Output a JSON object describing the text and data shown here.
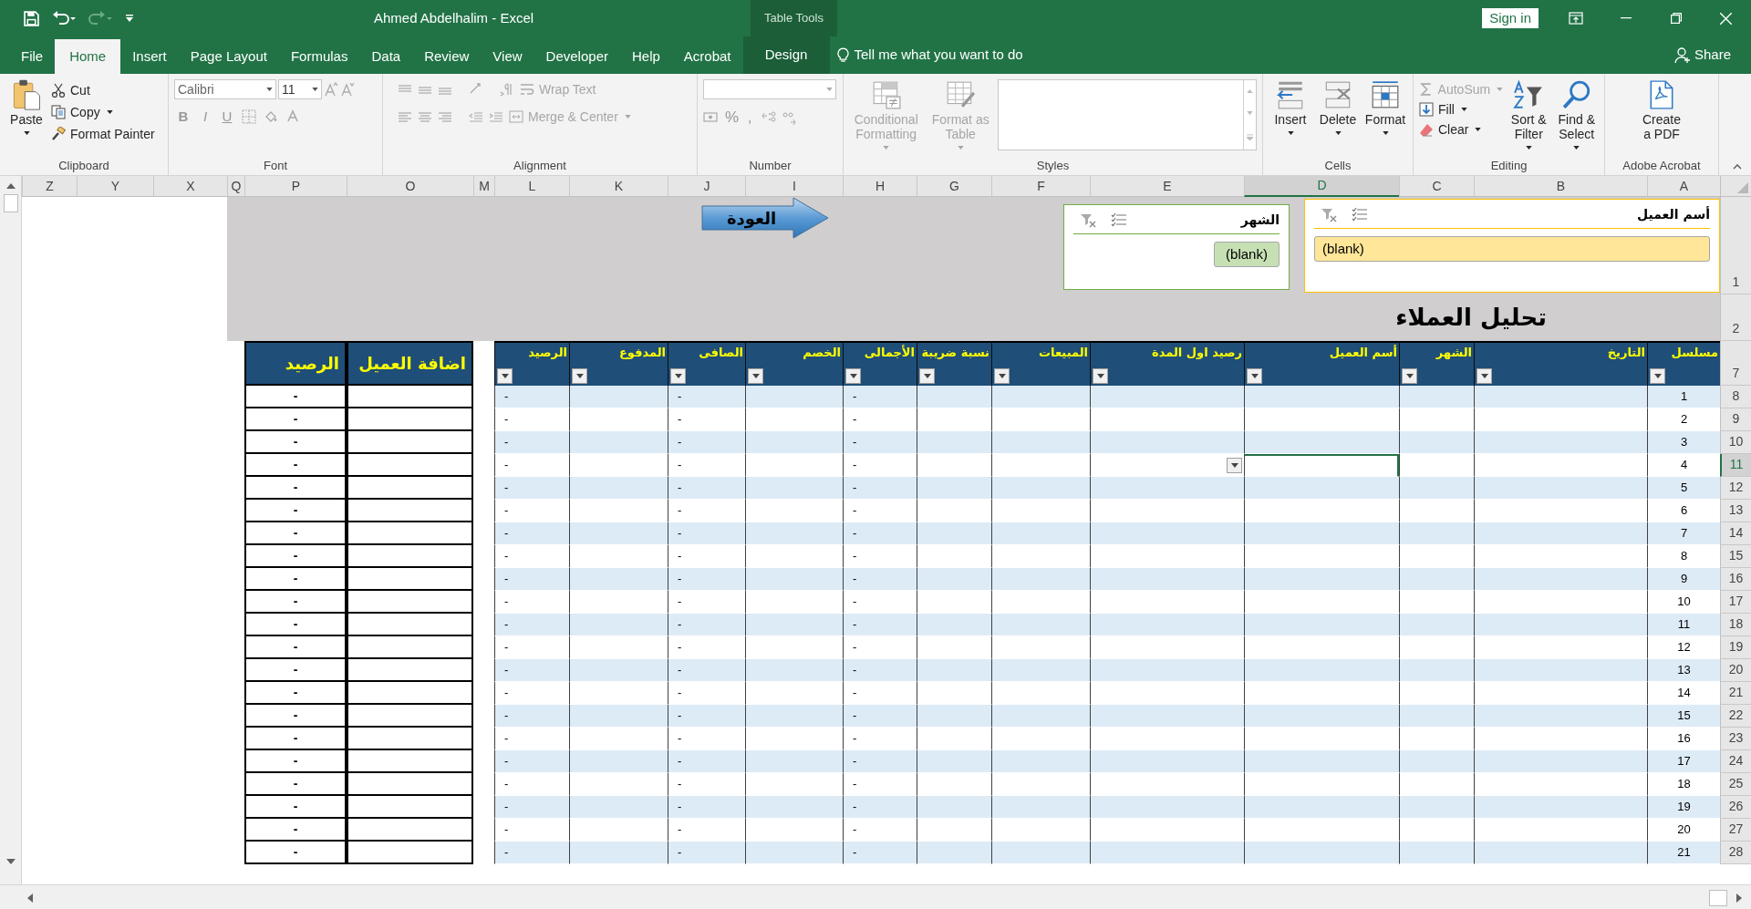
{
  "window": {
    "title": "Ahmed Abdelhalim  -  Excel",
    "context_label": "Table Tools",
    "sign_in": "Sign in"
  },
  "ribbon_tabs": [
    {
      "label": "File",
      "selected": false,
      "kind": "tab"
    },
    {
      "label": "Home",
      "selected": true,
      "kind": "tab"
    },
    {
      "label": "Insert",
      "selected": false,
      "kind": "tab"
    },
    {
      "label": "Page Layout",
      "selected": false,
      "kind": "tab"
    },
    {
      "label": "Formulas",
      "selected": false,
      "kind": "tab"
    },
    {
      "label": "Data",
      "selected": false,
      "kind": "tab"
    },
    {
      "label": "Review",
      "selected": false,
      "kind": "tab"
    },
    {
      "label": "View",
      "selected": false,
      "kind": "tab"
    },
    {
      "label": "Developer",
      "selected": false,
      "kind": "tab"
    },
    {
      "label": "Help",
      "selected": false,
      "kind": "tab"
    },
    {
      "label": "Acrobat",
      "selected": false,
      "kind": "tab"
    },
    {
      "label": "Design",
      "selected": false,
      "kind": "contextual"
    }
  ],
  "tell_me": "Tell me what you want to do",
  "share": "Share",
  "ribbon_groups": [
    {
      "kind": "clipboard",
      "name": "Clipboard",
      "commands": [
        {
          "label": "Paste",
          "disabled": false,
          "dropdown": true
        },
        {
          "label": "Cut",
          "disabled": false,
          "dropdown": false
        },
        {
          "label": "Copy",
          "disabled": false,
          "dropdown": true
        },
        {
          "label": "Format Painter",
          "disabled": false,
          "dropdown": false
        }
      ]
    },
    {
      "kind": "font",
      "name": "Font",
      "font_name": "Calibri",
      "font_size": "11",
      "format_buttons": [
        "B",
        "I",
        "U"
      ]
    },
    {
      "kind": "alignment",
      "name": "Alignment",
      "commands": [
        {
          "label": "Wrap Text",
          "disabled": true,
          "dropdown": false
        },
        {
          "label": "Merge & Center",
          "disabled": true,
          "dropdown": true
        }
      ]
    },
    {
      "kind": "number",
      "name": "Number",
      "symbols": [
        "%",
        ","
      ]
    },
    {
      "kind": "styles",
      "name": "Styles",
      "commands": [
        {
          "label": "Conditional\nFormatting",
          "disabled": true,
          "dropdown": true
        },
        {
          "label": "Format as\nTable",
          "disabled": true,
          "dropdown": true
        }
      ]
    },
    {
      "kind": "cells",
      "name": "Cells",
      "commands": [
        {
          "label": "Insert",
          "disabled": false,
          "dropdown": true
        },
        {
          "label": "Delete",
          "disabled": false,
          "dropdown": true
        },
        {
          "label": "Format",
          "disabled": false,
          "dropdown": true
        }
      ]
    },
    {
      "kind": "editing",
      "name": "Editing",
      "commands": [
        {
          "label": "AutoSum",
          "disabled": true,
          "dropdown": true
        },
        {
          "label": "Fill",
          "disabled": false,
          "dropdown": true
        },
        {
          "label": "Clear",
          "disabled": false,
          "dropdown": true
        },
        {
          "label": "Sort &\nFilter",
          "disabled": false,
          "dropdown": true
        },
        {
          "label": "Find &\nSelect",
          "disabled": false,
          "dropdown": true
        }
      ]
    },
    {
      "kind": "acrobat",
      "name": "Adobe Acrobat",
      "commands": [
        {
          "label": "Create\na PDF",
          "disabled": false,
          "dropdown": false
        }
      ]
    }
  ],
  "sheet": {
    "column_headers": [
      {
        "label": "Z",
        "selected": false
      },
      {
        "label": "Y",
        "selected": false
      },
      {
        "label": "X",
        "selected": false
      },
      {
        "label": "Q",
        "selected": false
      },
      {
        "label": "P",
        "selected": false
      },
      {
        "label": "O",
        "selected": false
      },
      {
        "label": "M",
        "selected": false
      },
      {
        "label": "L",
        "selected": false
      },
      {
        "label": "K",
        "selected": false
      },
      {
        "label": "J",
        "selected": false
      },
      {
        "label": "I",
        "selected": false
      },
      {
        "label": "H",
        "selected": false
      },
      {
        "label": "G",
        "selected": false
      },
      {
        "label": "F",
        "selected": false
      },
      {
        "label": "E",
        "selected": false
      },
      {
        "label": "D",
        "selected": true
      },
      {
        "label": "C",
        "selected": false
      },
      {
        "label": "B",
        "selected": false
      },
      {
        "label": "A",
        "selected": false
      }
    ],
    "top_rows": [
      "1",
      "2"
    ],
    "slicers": [
      {
        "kind": "green",
        "title": "الشهر",
        "items": [
          {
            "label": "(blank)",
            "selected": true
          }
        ]
      },
      {
        "kind": "orange",
        "title": "أسم العميل",
        "items": [
          {
            "label": "(blank)",
            "selected": true
          }
        ]
      }
    ],
    "back_button": "العودة",
    "title": "تحليل العملاء",
    "header_row": "7",
    "table_columns": [
      "مسلسل",
      "التاريخ",
      "الشهر",
      "أسم العميل",
      "رصيد اول المدة",
      "المبيعات",
      "نسبة ضريبة",
      "الأجمالى",
      "الخصم",
      "الصافى",
      "المدفوع",
      "الرصيد"
    ],
    "side_columns": [
      "اضافة العميل",
      "الرصيد"
    ],
    "rows": [
      {
        "row": "8",
        "serial": "1",
        "total": "-",
        "net": "-",
        "balance": "-",
        "side_balance": "-",
        "selected": false
      },
      {
        "row": "9",
        "serial": "2",
        "total": "-",
        "net": "-",
        "balance": "-",
        "side_balance": "-",
        "selected": false
      },
      {
        "row": "10",
        "serial": "3",
        "total": "-",
        "net": "-",
        "balance": "-",
        "side_balance": "-",
        "selected": false
      },
      {
        "row": "11",
        "serial": "4",
        "total": "-",
        "net": "-",
        "balance": "-",
        "side_balance": "-",
        "selected": true
      },
      {
        "row": "12",
        "serial": "5",
        "total": "-",
        "net": "-",
        "balance": "-",
        "side_balance": "-",
        "selected": false
      },
      {
        "row": "13",
        "serial": "6",
        "total": "-",
        "net": "-",
        "balance": "-",
        "side_balance": "-",
        "selected": false
      },
      {
        "row": "14",
        "serial": "7",
        "total": "-",
        "net": "-",
        "balance": "-",
        "side_balance": "-",
        "selected": false
      },
      {
        "row": "15",
        "serial": "8",
        "total": "-",
        "net": "-",
        "balance": "-",
        "side_balance": "-",
        "selected": false
      },
      {
        "row": "16",
        "serial": "9",
        "total": "-",
        "net": "-",
        "balance": "-",
        "side_balance": "-",
        "selected": false
      },
      {
        "row": "17",
        "serial": "10",
        "total": "-",
        "net": "-",
        "balance": "-",
        "side_balance": "-",
        "selected": false
      },
      {
        "row": "18",
        "serial": "11",
        "total": "-",
        "net": "-",
        "balance": "-",
        "side_balance": "-",
        "selected": false
      },
      {
        "row": "19",
        "serial": "12",
        "total": "-",
        "net": "-",
        "balance": "-",
        "side_balance": "-",
        "selected": false
      },
      {
        "row": "20",
        "serial": "13",
        "total": "-",
        "net": "-",
        "balance": "-",
        "side_balance": "-",
        "selected": false
      },
      {
        "row": "21",
        "serial": "14",
        "total": "-",
        "net": "-",
        "balance": "-",
        "side_balance": "-",
        "selected": false
      },
      {
        "row": "22",
        "serial": "15",
        "total": "-",
        "net": "-",
        "balance": "-",
        "side_balance": "-",
        "selected": false
      },
      {
        "row": "23",
        "serial": "16",
        "total": "-",
        "net": "-",
        "balance": "-",
        "side_balance": "-",
        "selected": false
      },
      {
        "row": "24",
        "serial": "17",
        "total": "-",
        "net": "-",
        "balance": "-",
        "side_balance": "-",
        "selected": false
      },
      {
        "row": "25",
        "serial": "18",
        "total": "-",
        "net": "-",
        "balance": "-",
        "side_balance": "-",
        "selected": false
      },
      {
        "row": "26",
        "serial": "19",
        "total": "-",
        "net": "-",
        "balance": "-",
        "side_balance": "-",
        "selected": false
      },
      {
        "row": "27",
        "serial": "20",
        "total": "-",
        "net": "-",
        "balance": "-",
        "side_balance": "-",
        "selected": false
      },
      {
        "row": "28",
        "serial": "21",
        "total": "-",
        "net": "-",
        "balance": "-",
        "side_balance": "-",
        "selected": false
      }
    ]
  }
}
